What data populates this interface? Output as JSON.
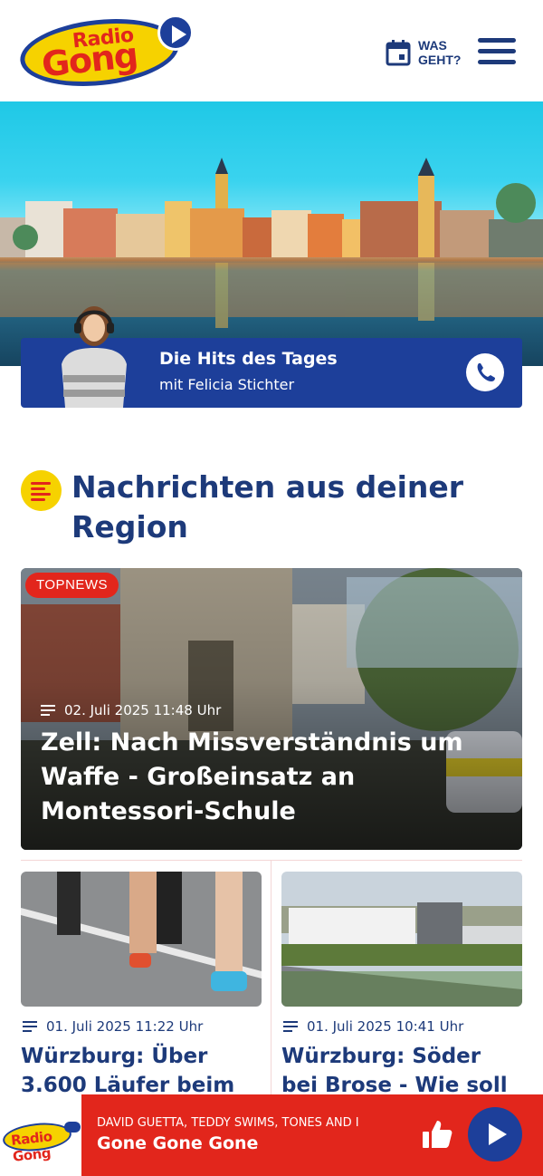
{
  "header": {
    "logo_line1": "Radio",
    "logo_line2": "Gong",
    "was_geht_label": "WAS GEHT?",
    "icons": {
      "calendar": "calendar-icon",
      "menu": "hamburger-menu-icon",
      "logo_play": "play-icon"
    }
  },
  "show": {
    "title": "Die Hits des Tages",
    "subtitle": "mit Felicia Stichter",
    "icon": "whatsapp-icon"
  },
  "news": {
    "section_title": "Nachrichten aus deiner Region",
    "top_story": {
      "badge": "TOPNEWS",
      "date": "02. Juli 2025 11:48 Uhr",
      "headline": "Zell: Nach Missverständnis um Waffe - Großeinsatz an Montessori-Schule"
    },
    "cards": [
      {
        "date": "01. Juli 2025 11:22 Uhr",
        "title": "Würzburg: Über 3.600 Läufer beim"
      },
      {
        "date": "01. Juli 2025 10:41 Uhr",
        "title": "Würzburg: Söder bei Brose - Wie soll die"
      }
    ]
  },
  "player": {
    "mini_logo": "Radio Gong",
    "artist": "DAVID GUETTA, TEDDY SWIMS, TONES AND I",
    "song": "Gone Gone Gone",
    "icons": {
      "like": "thumbs-up-icon",
      "play": "play-icon"
    }
  },
  "colors": {
    "brand_blue": "#1d3f9a",
    "brand_red": "#e2261c",
    "brand_yellow": "#f6d200"
  }
}
